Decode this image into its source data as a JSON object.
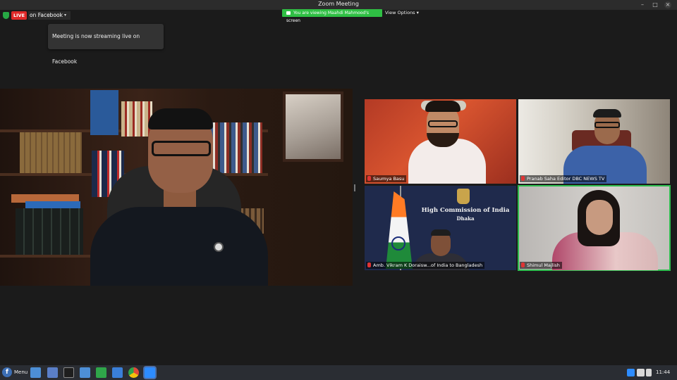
{
  "window": {
    "title": "Zoom Meeting",
    "controls": {
      "minimize": "–",
      "maximize": "□",
      "close": "×"
    }
  },
  "live": {
    "badge": "LIVE",
    "label": "on Facebook",
    "caret": "▾",
    "tooltip": "Meeting is now streaming live on Facebook"
  },
  "screen_share": {
    "banner": "You are viewing Maahdi Mahmood's screen",
    "view_options": "View Options ▾"
  },
  "participants": [
    {
      "name": "Saumya Basu"
    },
    {
      "name": "Pranab Saha Editor DBC NEWS TV"
    },
    {
      "name": "Amb. Vikram K Doraisw...of India to Bangladesh"
    },
    {
      "name": "Shimul Majlish"
    }
  ],
  "backdrop": {
    "line1": "High Commission of India",
    "line2": "Dhaka"
  },
  "taskbar": {
    "logo": "f",
    "menu": "Menu",
    "clock": "11:44"
  },
  "colors": {
    "live_red": "#e02828",
    "active_speaker_green": "#2ebd4e",
    "banner_green": "#2fbf44"
  }
}
